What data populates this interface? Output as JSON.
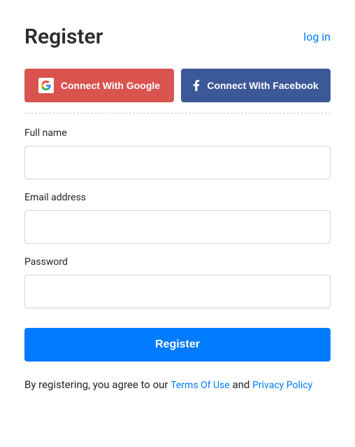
{
  "header": {
    "title": "Register",
    "login_link": "log in"
  },
  "social": {
    "google_label": "Connect With Google",
    "facebook_label": "Connect With Facebook"
  },
  "form": {
    "fullname_label": "Full name",
    "email_label": "Email address",
    "password_label": "Password",
    "submit_label": "Register"
  },
  "terms": {
    "prefix": "By registering, you agree to our ",
    "terms_link": "Terms Of Use",
    "and": " and ",
    "privacy_link": "Privacy Policy"
  }
}
